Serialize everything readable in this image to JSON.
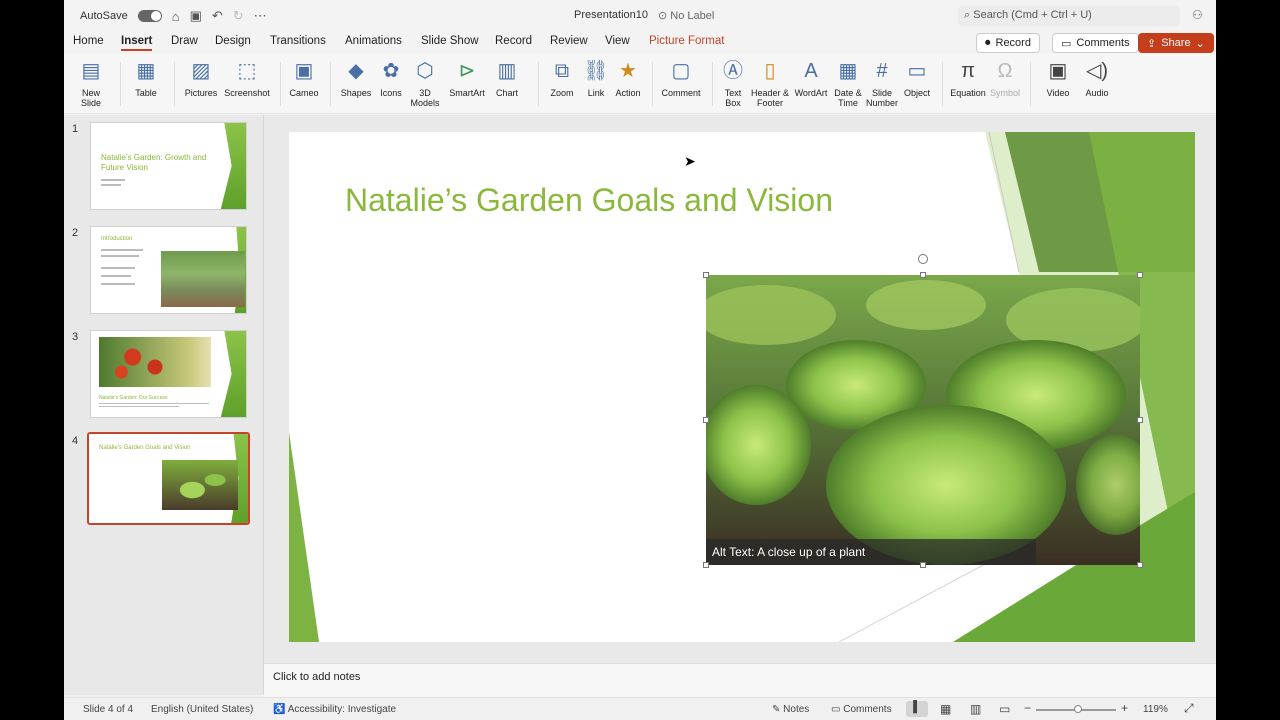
{
  "titlebar": {
    "autosave_label": "AutoSave",
    "doc_name": "Presentation10",
    "label_status": "No Label",
    "search_placeholder": "Search (Cmd + Ctrl + U)"
  },
  "tabs": [
    "Home",
    "Insert",
    "Draw",
    "Design",
    "Transitions",
    "Animations",
    "Slide Show",
    "Record",
    "Review",
    "View",
    "Picture Format"
  ],
  "active_tab": "Insert",
  "buttons": {
    "record": "Record",
    "comments": "Comments",
    "share": "Share"
  },
  "ribbon": {
    "new_slide": "New Slide",
    "table": "Table",
    "pictures": "Pictures",
    "screenshot": "Screenshot",
    "cameo": "Cameo",
    "shapes": "Shapes",
    "icons": "Icons",
    "models_3d": "3D Models",
    "smartart": "SmartArt",
    "chart": "Chart",
    "zoom": "Zoom",
    "link": "Link",
    "action": "Action",
    "comment": "Comment",
    "text_box": "Text Box",
    "header_footer": "Header & Footer",
    "wordart": "WordArt",
    "date_time": "Date & Time",
    "slide_number": "Slide Number",
    "object": "Object",
    "equation": "Equation",
    "symbol": "Symbol",
    "video": "Video",
    "audio": "Audio"
  },
  "thumbnails": [
    {
      "num": "1",
      "title": "Natalie’s Garden: Growth and Future Vision"
    },
    {
      "num": "2",
      "title": "Introduction"
    },
    {
      "num": "3",
      "title": "Natalie’s Garden: Our Success"
    },
    {
      "num": "4",
      "title": "Natalie’s Garden Goals and Vision"
    }
  ],
  "slide": {
    "title": "Natalie’s Garden Goals and Vision",
    "alt_text": "Alt Text: A close up of a plant"
  },
  "notes_placeholder": "Click to add notes",
  "status": {
    "slide_of": "Slide 4 of 4",
    "language": "English (United States)",
    "accessibility": "Accessibility: Investigate",
    "notes": "Notes",
    "comments": "Comments",
    "zoom": "119%"
  },
  "colors": {
    "accent_red": "#c4442a",
    "green_title": "#8ab83a",
    "green_band": "#6aa83a"
  }
}
